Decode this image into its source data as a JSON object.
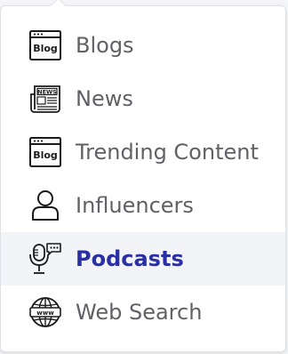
{
  "menu": {
    "items": [
      {
        "label": "Blogs",
        "icon": "blog-icon",
        "badge": "Blog"
      },
      {
        "label": "News",
        "icon": "newspaper-icon",
        "badge": "NEWS"
      },
      {
        "label": "Trending Content",
        "icon": "blog-icon",
        "badge": "Blog"
      },
      {
        "label": "Influencers",
        "icon": "person-icon"
      },
      {
        "label": "Podcasts",
        "icon": "microphone-icon",
        "selected": true
      },
      {
        "label": "Web Search",
        "icon": "globe-icon",
        "badge": "www"
      }
    ],
    "active_color": "#2a2fa3",
    "text_color": "#5f6166"
  }
}
